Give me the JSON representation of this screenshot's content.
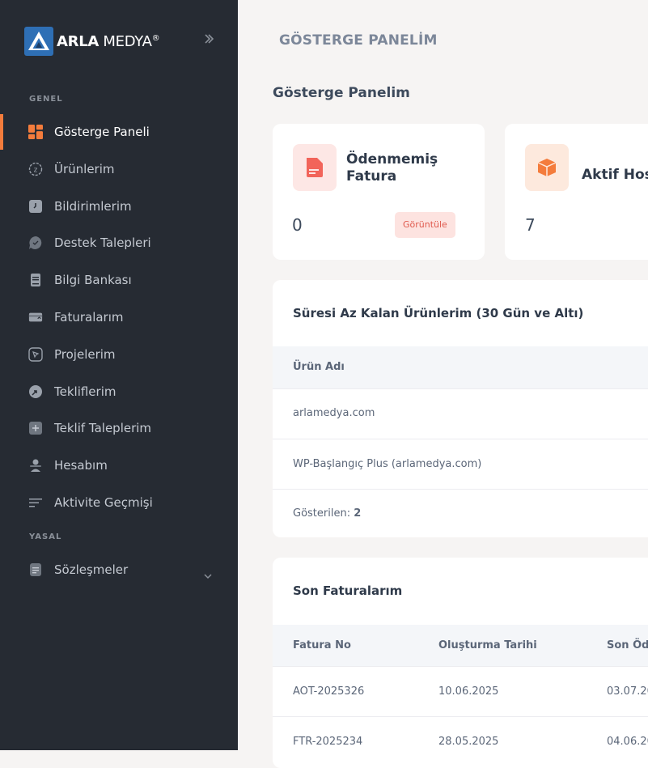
{
  "brand": {
    "name_bold": "ARLA",
    "name_light": "MEDYA",
    "mark": "®"
  },
  "sidebar": {
    "section_general": "GENEL",
    "section_legal": "YASAL",
    "items": [
      {
        "label": "Gösterge Paneli",
        "icon": "dashboard-icon",
        "active": true
      },
      {
        "label": "Ürünlerim",
        "icon": "products-icon"
      },
      {
        "label": "Bildirimlerim",
        "icon": "notifications-icon"
      },
      {
        "label": "Destek Talepleri",
        "icon": "support-icon"
      },
      {
        "label": "Bilgi Bankası",
        "icon": "book-icon"
      },
      {
        "label": "Faturalarım",
        "icon": "invoice-icon"
      },
      {
        "label": "Projelerim",
        "icon": "projects-icon"
      },
      {
        "label": "Tekliflerim",
        "icon": "offers-icon"
      },
      {
        "label": "Teklif Taleplerim",
        "icon": "plus-icon"
      },
      {
        "label": "Hesabım",
        "icon": "user-icon"
      },
      {
        "label": "Aktivite Geçmişi",
        "icon": "activity-icon"
      }
    ],
    "legal_items": [
      {
        "label": "Sözleşmeler",
        "icon": "document-icon"
      }
    ]
  },
  "header": {
    "breadcrumb": "GÖSTERGE PANELİM"
  },
  "main": {
    "page_title": "Gösterge Panelim",
    "stats": [
      {
        "title": "Ödenmemiş Fatura",
        "value": "0",
        "button": "Görüntüle",
        "accent": "#f2645a"
      },
      {
        "title": "Aktif Host",
        "value": "7",
        "accent": "#f47c3c"
      }
    ],
    "expiring": {
      "title": "Süresi Az Kalan Ürünlerim (30 Gün ve Altı)",
      "col_product": "Ürün Adı",
      "rows": [
        {
          "name": "arlamedya.com"
        },
        {
          "name": "WP-Başlangıç Plus (arlamedya.com)"
        }
      ],
      "shown_label": "Gösterilen:",
      "shown_count": "2"
    },
    "invoices": {
      "title": "Son Faturalarım",
      "col_no": "Fatura No",
      "col_created": "Oluşturma Tarihi",
      "col_due": "Son Öd",
      "rows": [
        {
          "no": "AOT-2025326",
          "created": "10.06.2025",
          "due": "03.07.20"
        },
        {
          "no": "FTR-2025234",
          "created": "28.05.2025",
          "due": "04.06.20"
        }
      ]
    }
  }
}
